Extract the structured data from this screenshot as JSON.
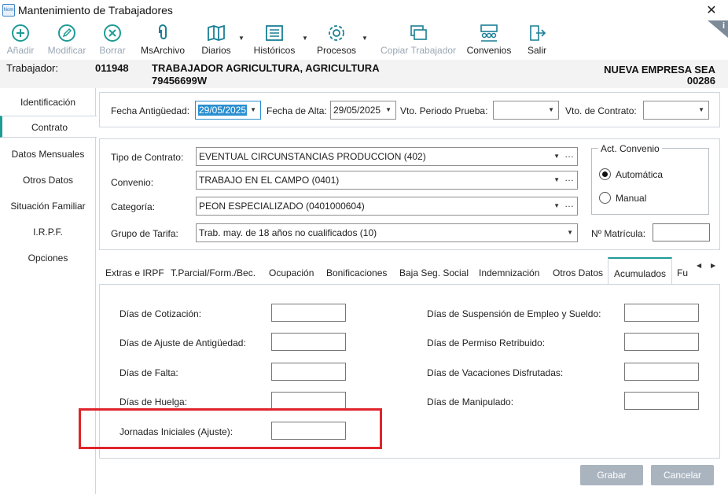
{
  "window": {
    "title": "Mantenimiento de Trabajadores",
    "app_icon_text": "Nom"
  },
  "toolbar": {
    "anadir": "Añadir",
    "modificar": "Modificar",
    "borrar": "Borrar",
    "msarchivo": "MsArchivo",
    "diarios": "Diarios",
    "historicos": "Históricos",
    "procesos": "Procesos",
    "copiar": "Copiar Trabajador",
    "convenios": "Convenios",
    "salir": "Salir",
    "info": "i"
  },
  "header": {
    "trabajador_label": "Trabajador:",
    "code": "011948",
    "name": "TRABAJADOR AGRICULTURA, AGRICULTURA",
    "dni": "79456699W",
    "company": "NUEVA EMPRESA SEA",
    "company_code": "00286"
  },
  "sidebar": {
    "items": [
      "Identificación",
      "Contrato",
      "Datos Mensuales",
      "Otros Datos",
      "Situación Familiar",
      "I.R.P.F.",
      "Opciones"
    ],
    "active": "Contrato"
  },
  "dates": {
    "antiguedad_label": "Fecha Antigüedad:",
    "antiguedad_value": "29/05/2025",
    "alta_label": "Fecha de Alta:",
    "alta_value": "29/05/2025",
    "prueba_label": "Vto. Periodo Prueba:",
    "contrato_label": "Vto. de Contrato:"
  },
  "contract": {
    "tipo_label": "Tipo de Contrato:",
    "tipo_value": "EVENTUAL CIRCUNSTANCIAS PRODUCCION (402)",
    "convenio_label": "Convenio:",
    "convenio_value": "TRABAJO EN EL CAMPO (0401)",
    "categoria_label": "Categoría:",
    "categoria_value": "PEON ESPECIALIZADO (0401000604)",
    "tarifa_label": "Grupo de Tarifa:",
    "tarifa_value": "Trab. may. de 18 años no cualificados (10)",
    "act_convenio_title": "Act. Convenio",
    "automatica": "Automática",
    "manual": "Manual",
    "matricula_label": "Nº Matrícula:"
  },
  "tabs": [
    "Extras e IRPF",
    "T.Parcial/Form./Bec.",
    "Ocupación",
    "Bonificaciones",
    "Baja Seg. Social",
    "Indemnización",
    "Otros Datos",
    "Acumulados",
    "Fu"
  ],
  "acumulados": {
    "left": [
      "Días de Cotización:",
      "Días de Ajuste de Antigüedad:",
      "Días de Falta:",
      "Días de Huelga:",
      "Jornadas Iniciales (Ajuste):"
    ],
    "right": [
      "Días de Suspensión de Empleo y Sueldo:",
      "Días de Permiso Retribuido:",
      "Días de Vacaciones Disfrutadas:",
      "Días de Manipulado:"
    ]
  },
  "buttons": {
    "grabar": "Grabar",
    "cancelar": "Cancelar"
  },
  "colors": {
    "accent": "#1f9b96",
    "selection": "#2a8fd0",
    "highlight": "#e0242b",
    "disabled_button": "#a9b4bf"
  }
}
